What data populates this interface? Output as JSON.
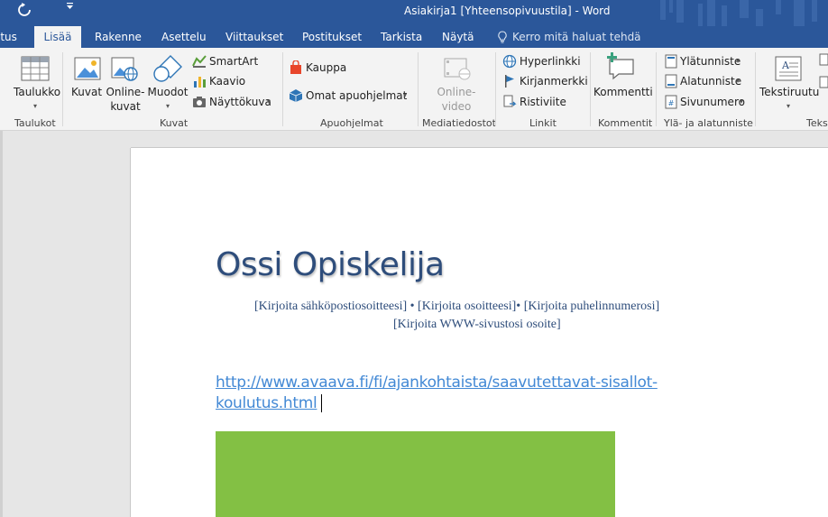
{
  "titlebar": {
    "title": "Asiakirja1 [Yhteensopivuustila] - Word",
    "undo_icon": "repeat-icon",
    "qat_icon": "customize-qat-icon",
    "background": "#2b579a"
  },
  "tabs": [
    {
      "label": "itus"
    },
    {
      "label": "Lisää",
      "active": true
    },
    {
      "label": "Rakenne"
    },
    {
      "label": "Asettelu"
    },
    {
      "label": "Viittaukset"
    },
    {
      "label": "Postitukset"
    },
    {
      "label": "Tarkista"
    },
    {
      "label": "Näytä"
    }
  ],
  "tell_me": {
    "label": "Kerro mitä haluat tehdä",
    "icon": "lightbulb-icon"
  },
  "ribbon": {
    "tables": {
      "button": "Taulukko",
      "group": "Taulukot"
    },
    "illustrations": {
      "pictures": "Kuvat",
      "online_pictures_line1": "Online-",
      "online_pictures_line2": "kuvat",
      "shapes": "Muodot",
      "smartart": "SmartArt",
      "chart": "Kaavio",
      "screenshot": "Näyttökuva",
      "group": "Kuvat"
    },
    "addins": {
      "store": "Kauppa",
      "my_addins": "Omat apuohjelmat",
      "group": "Apuohjelmat"
    },
    "media": {
      "online_video_line1": "Online-",
      "online_video_line2": "video",
      "group": "Mediatiedostot"
    },
    "links": {
      "hyperlink": "Hyperlinkki",
      "bookmark": "Kirjanmerkki",
      "cross_reference": "Ristiviite",
      "group": "Linkit"
    },
    "comments": {
      "comment": "Kommentti",
      "group": "Kommentit"
    },
    "header_footer": {
      "header": "Ylätunniste",
      "footer": "Alatunniste",
      "page_number": "Sivunumero",
      "group": "Ylä- ja alatunniste"
    },
    "text": {
      "textbox": "Tekstiruutu",
      "group": "Tekst"
    }
  },
  "document": {
    "name": "Ossi Opiskelija",
    "contact_line1": "[Kirjoita sähköpostiosoitteesi] •  [Kirjoita osoitteesi]• [Kirjoita puhelinnumerosi]",
    "contact_line2": "[Kirjoita WWW-sivustosi osoite]",
    "link_text": "http://www.avaava.fi/fi/ajankohtaista/saavutettavat-sisallot-koulutus.html",
    "accent_color": "#2e4d7b",
    "link_color": "#4389d5",
    "block_color": "#83c044"
  }
}
